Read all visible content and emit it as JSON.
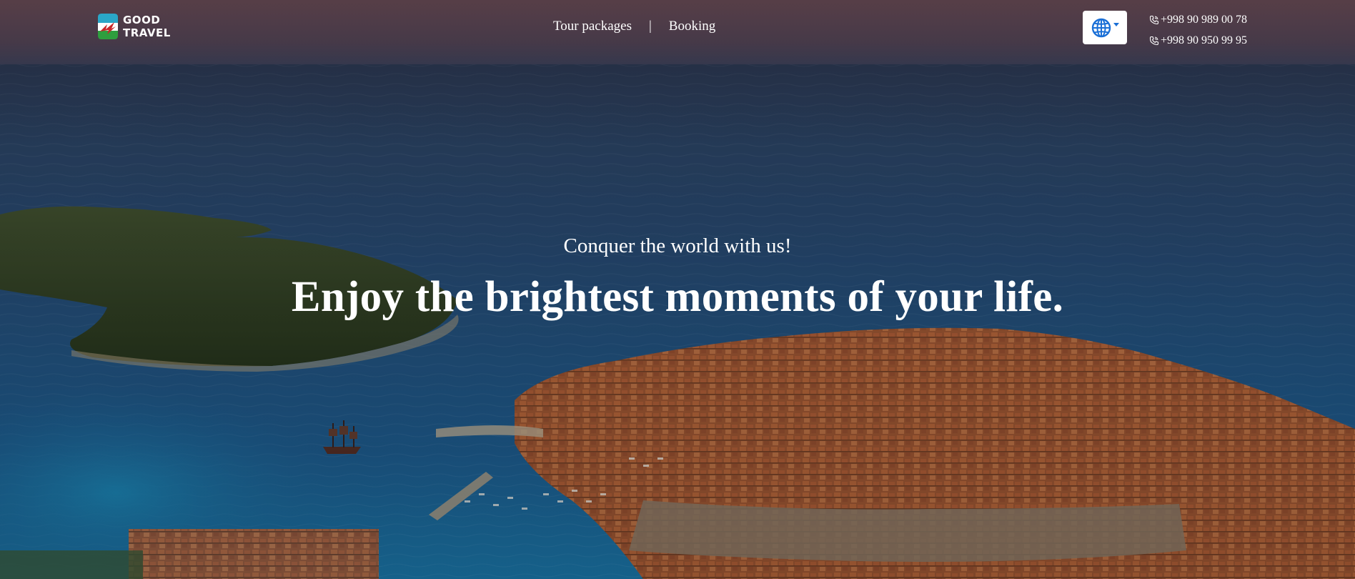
{
  "logo": {
    "line1": "GOOD",
    "line2": "TRAVEL",
    "colors": {
      "teal": "#2aa7c8",
      "green": "#2e9e3e",
      "red": "#c8282a"
    }
  },
  "nav": {
    "items": [
      {
        "label": "Tour packages"
      },
      {
        "label": "Booking"
      }
    ],
    "separator": "|"
  },
  "language_button": {
    "icon": "globe-icon",
    "indicator": "caret-down-icon",
    "color": "#1a6fd6"
  },
  "phones": [
    {
      "number": "+998 90 989 00 78",
      "icon": "phone-icon"
    },
    {
      "number": "+998 90 950 99 95",
      "icon": "phone-icon"
    }
  ],
  "hero": {
    "subtitle": "Conquer the world with us!",
    "title": "Enjoy the brightest moments of your life."
  }
}
